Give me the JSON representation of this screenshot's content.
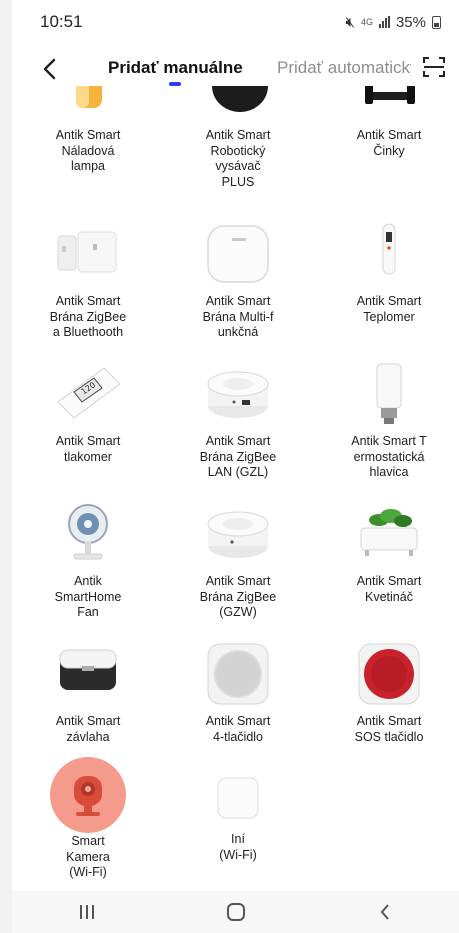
{
  "status": {
    "time": "10:51",
    "network": "4G",
    "battery": "35%"
  },
  "header": {
    "back_icon": "chevron-left-icon",
    "tab_manual": "Pridať manuálne",
    "tab_auto": "Pridať automaticky",
    "scan_icon": "scan-icon"
  },
  "devices": [
    {
      "lines": [
        "Antik Smart",
        "Náladová",
        "lampa"
      ],
      "icon": "mood-lamp"
    },
    {
      "lines": [
        "Antik Smart",
        "Robotický",
        "vysávač",
        "PLUS"
      ],
      "icon": "robot-vacuum"
    },
    {
      "lines": [
        "Antik Smart",
        "Činky"
      ],
      "icon": "dumbbells"
    },
    {
      "lines": [
        "Antik Smart",
        "Brána ZigBee",
        "a Bluethooth"
      ],
      "icon": "zigbee-bluetooth-gateway"
    },
    {
      "lines": [
        "Antik Smart",
        "Brána Multi-f",
        "unkčná"
      ],
      "icon": "multifunction-gateway"
    },
    {
      "lines": [
        "Antik Smart",
        "Teplomer"
      ],
      "icon": "thermometer"
    },
    {
      "lines": [
        "Antik Smart",
        "tlakomer"
      ],
      "icon": "blood-pressure-monitor"
    },
    {
      "lines": [
        "Antik Smart",
        "Brána ZigBee",
        "LAN (GZL)"
      ],
      "icon": "zigbee-lan-gateway"
    },
    {
      "lines": [
        "Antik Smart T",
        "ermostatická",
        "hlavica"
      ],
      "icon": "thermostatic-head"
    },
    {
      "lines": [
        "Antik",
        "SmartHome",
        "Fan"
      ],
      "icon": "fan"
    },
    {
      "lines": [
        "Antik Smart",
        "Brána ZigBee",
        "(GZW)"
      ],
      "icon": "zigbee-wifi-gateway"
    },
    {
      "lines": [
        "Antik Smart",
        "Kvetináč"
      ],
      "icon": "flower-pot"
    },
    {
      "lines": [
        "Antik Smart",
        "závlaha"
      ],
      "icon": "irrigation"
    },
    {
      "lines": [
        "Antik Smart",
        "4-tlačidlo"
      ],
      "icon": "four-button-switch"
    },
    {
      "lines": [
        "Antik Smart",
        "SOS tlačidlo"
      ],
      "icon": "sos-button"
    },
    {
      "lines": [
        "Smart",
        "Kamera",
        "(Wi-Fi)"
      ],
      "icon": "camera"
    },
    {
      "lines": [
        "Iní",
        "(Wi-Fi)"
      ],
      "icon": "other-device"
    }
  ],
  "colors": {
    "accent": "#2a3cff",
    "highlight": "#f59b8b",
    "sos_red": "#c8232c"
  },
  "nav": {
    "recents_icon": "recents-icon",
    "home_icon": "home-icon",
    "back_icon": "back-icon"
  }
}
